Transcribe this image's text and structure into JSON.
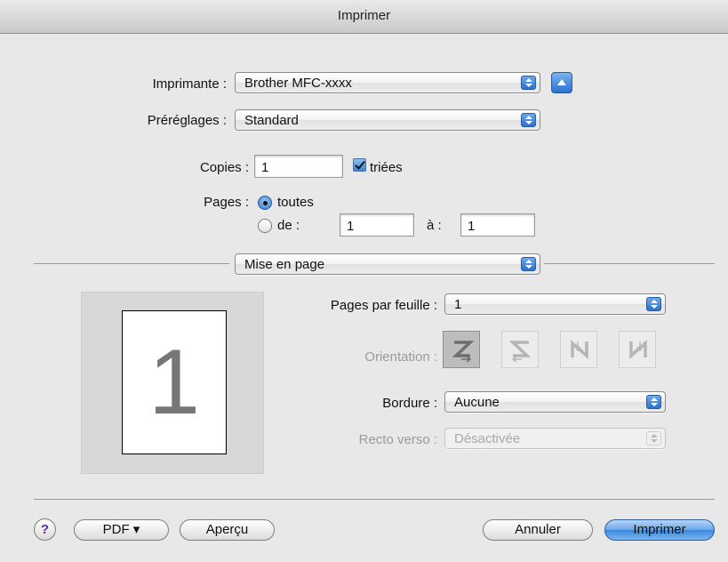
{
  "window": {
    "title": "Imprimer"
  },
  "printer": {
    "label": "Imprimante :",
    "value": "Brother MFC-xxxx"
  },
  "presets": {
    "label": "Préréglages :",
    "value": "Standard"
  },
  "copies": {
    "label": "Copies :",
    "value": "1",
    "collated_label": "triées",
    "collated_checked": true
  },
  "pages": {
    "label": "Pages :",
    "all_label": "toutes",
    "from_label": "de :",
    "from_value": "1",
    "to_label": "à :",
    "to_value": "1",
    "selected": "all"
  },
  "section": {
    "value": "Mise en page"
  },
  "layout": {
    "preview_number": "1",
    "pages_per_sheet": {
      "label": "Pages par feuille :",
      "value": "1"
    },
    "orientation": {
      "label": "Orientation :",
      "options": [
        "z",
        "s-reverse",
        "n-reverse",
        "n"
      ],
      "selected_index": 0
    },
    "border": {
      "label": "Bordure :",
      "value": "Aucune"
    },
    "duplex": {
      "label": "Recto verso :",
      "value": "Désactivée"
    }
  },
  "buttons": {
    "help": "?",
    "pdf": "PDF ▾",
    "preview": "Aperçu",
    "cancel": "Annuler",
    "print": "Imprimer"
  },
  "colors": {
    "accent": "#3d88dc",
    "window_bg": "#e8e8e8"
  }
}
